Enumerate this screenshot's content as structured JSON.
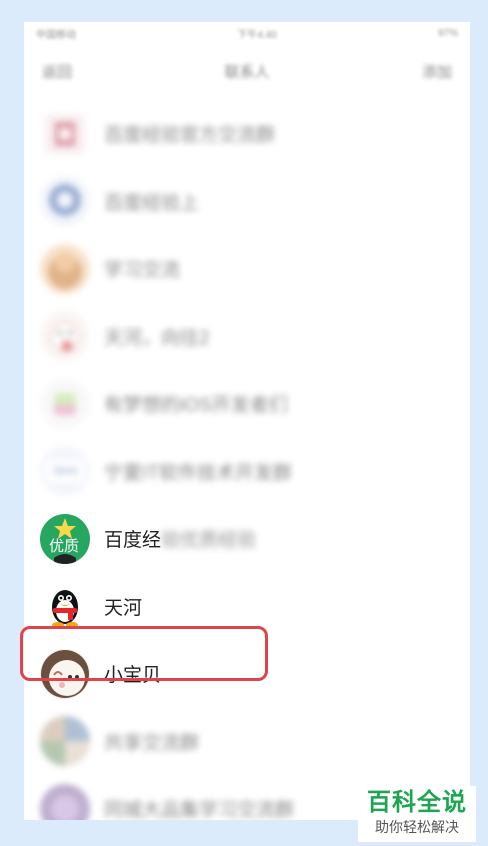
{
  "status_bar": {
    "carrier": "中国移动",
    "time": "下午4:40",
    "battery": "97%"
  },
  "nav": {
    "back_label": "返回",
    "title": "联系人",
    "right_label": "添加"
  },
  "contacts": [
    {
      "name": "百度经验官方交流群",
      "blurred": true
    },
    {
      "name": "百度经验上",
      "blurred": true
    },
    {
      "name": "学习交流",
      "blurred": true
    },
    {
      "name": "天河，向往2",
      "blurred": true
    },
    {
      "name": "有梦想的iOS开发者们",
      "blurred": true
    },
    {
      "name": "宁夏IT软件技术开发群",
      "blurred": true,
      "avatar_text": "Java"
    },
    {
      "name": "百度经",
      "name_blurred_tail": "验优质经验",
      "blurred": false,
      "avatar_text": "优质"
    },
    {
      "name": "天河",
      "blurred": false
    },
    {
      "name": "小宝贝",
      "blurred": false,
      "highlighted": true
    },
    {
      "name": "共享交流群",
      "blurred": true
    },
    {
      "name": "同城大品集学习交流群",
      "blurred": true
    }
  ],
  "watermark": {
    "title": "百科全说",
    "subtitle": "助你轻松解决"
  },
  "colors": {
    "highlight": "#e0444b",
    "watermark_green": "#1fa552",
    "frame": "#dcebfb"
  }
}
